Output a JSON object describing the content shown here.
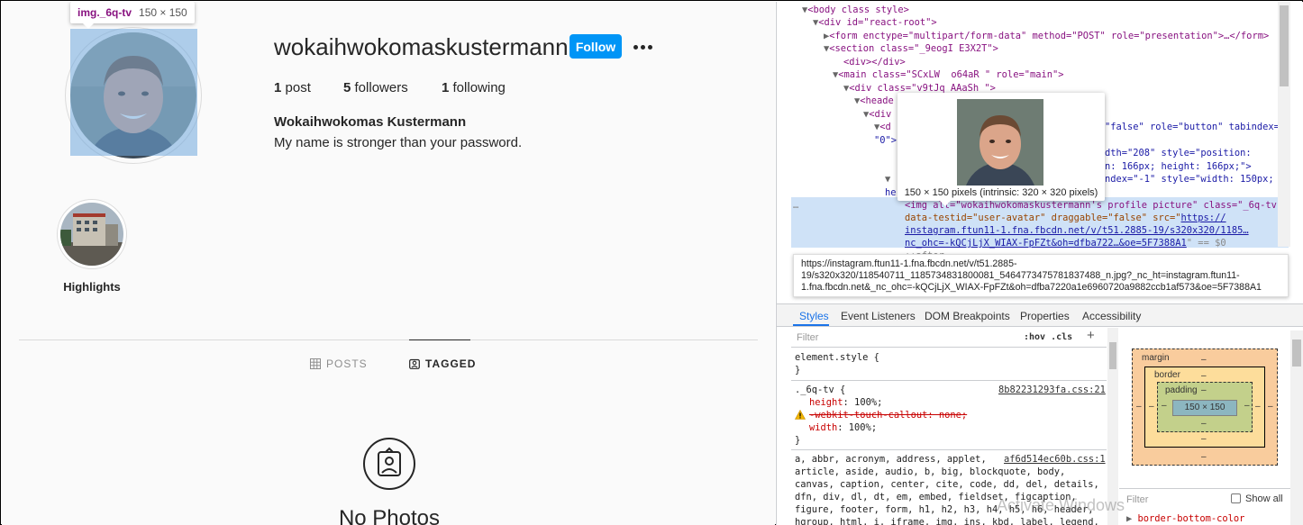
{
  "profile": {
    "username": "wokaihwokomaskustermann",
    "follow_label": "Follow",
    "posts_count": "1",
    "posts_label": "post",
    "followers_count": "5",
    "followers_label": "followers",
    "following_count": "1",
    "following_label": "following",
    "full_name": "Wokaihwokomas Kustermann",
    "bio": "My name is stronger than your password."
  },
  "inspect_tooltip": {
    "selector": "img._6q-tv",
    "size": "150 × 150"
  },
  "highlights": {
    "label": "Highlights"
  },
  "tabs": {
    "posts_label": "POSTS",
    "tagged_label": "TAGGED"
  },
  "empty_state": {
    "text": "No Photos"
  },
  "devtools": {
    "dom_lines": {
      "l1": "<body class style>",
      "l2": "<div id=\"react-root\">",
      "l3": "<form enctype=\"multipart/form-data\" method=\"POST\" role=\"presentation\">…</form>",
      "l4": "<section class=\"_9eogI E3X2T\">",
      "l5": "<div></div>",
      "l6": "<main class=\"SCxLW  o64aR \" role=\"main\">",
      "l7": "<div class=\"v9tJq AAaSh \">",
      "l8": "<heade",
      "l9": "<div",
      "l10a": "<d",
      "l10b": "\"false\" role=\"button\" tabindex=",
      "l11a": "\"0\">",
      "l12b": "dth=\"208\" style=\"position:",
      "l13b": "n: 166px; height: 166px;\">",
      "l14b": "ndex=\"-1\" style=\"width: 150px;",
      "l15a": "he",
      "l16": "<img alt=\"wokaihwokomaskustermann's profile picture\" class=\"_6q-tv\"",
      "l17": "data-testid=\"user-avatar\" draggable=\"false\" src=\"",
      "l17link": "https://",
      "l18": "instagram.ftun11-1.fna.fbcdn.net/v/t51.2885-19/s320x320/1185…",
      "l19": "nc_ohc=-kQCjLjX_WIAX-FpFZt&oh=dfba722…&oe=5F7388A1",
      "l19b": "\" == $0",
      "l20": "::after"
    },
    "image_preview_caption": "150 × 150 pixels (intrinsic: 320 × 320 pixels)",
    "url_tooltip": "https://instagram.ftun11-1.fna.fbcdn.net/v/t51.2885-19/s320x320/118540711_1185734831800081_5464773475781837488_n.jpg?_nc_ht=instagram.ftun11-1.fna.fbcdn.net&_nc_ohc=-kQCjLjX_WIAX-FpFZt&oh=dfba7220a1e6960720a9882ccb1af573&oe=5F7388A1",
    "panel_tabs": [
      "Styles",
      "Event Listeners",
      "DOM Breakpoints",
      "Properties",
      "Accessibility"
    ],
    "styles": {
      "filter_placeholder": "Filter",
      "hov_cls": ":hov  .cls",
      "element_style": "element.style {",
      "close_brace": "}",
      "rule1_selector": "._6q-tv {",
      "rule1_source": "8b82231293fa.css:21",
      "rule1_height_prop": "height",
      "rule1_height_val": ": 100%;",
      "rule1_webkit": "-webkit-touch-callout: none;",
      "rule1_width_prop": "width",
      "rule1_width_val": ": 100%;",
      "rule2_source": "af6d514ec60b.css:1",
      "rule2_l1": "a, abbr, acronym, address, applet,",
      "rule2_l2": "article, aside, audio, b, big, blockquote, body,",
      "rule2_l3": "canvas, caption, center, cite, code, dd, del, details,",
      "rule2_l4": "dfn, div, dl, dt, em, embed, fieldset, figcaption,",
      "rule2_l5": "figure, footer, form, h1, h2, h3, h4, h5, h6, header,",
      "rule2_l6": "hgroup, html, i, iframe, img, ins, kbd, label, legend,"
    },
    "box_model": {
      "margin_label": "margin",
      "border_label": "border",
      "padding_label": "padding",
      "dash": "–",
      "content_size": "150 × 150"
    },
    "computed": {
      "filter_placeholder": "Filter",
      "show_all_label": "Show all",
      "first_prop": "border-bottom-color"
    },
    "watermark": "Activate Windows"
  },
  "colors": {
    "follow_blue": "#0095f6",
    "selection_blue": "#cfe2f7",
    "highlight_overlay": "#6fa8dc"
  }
}
